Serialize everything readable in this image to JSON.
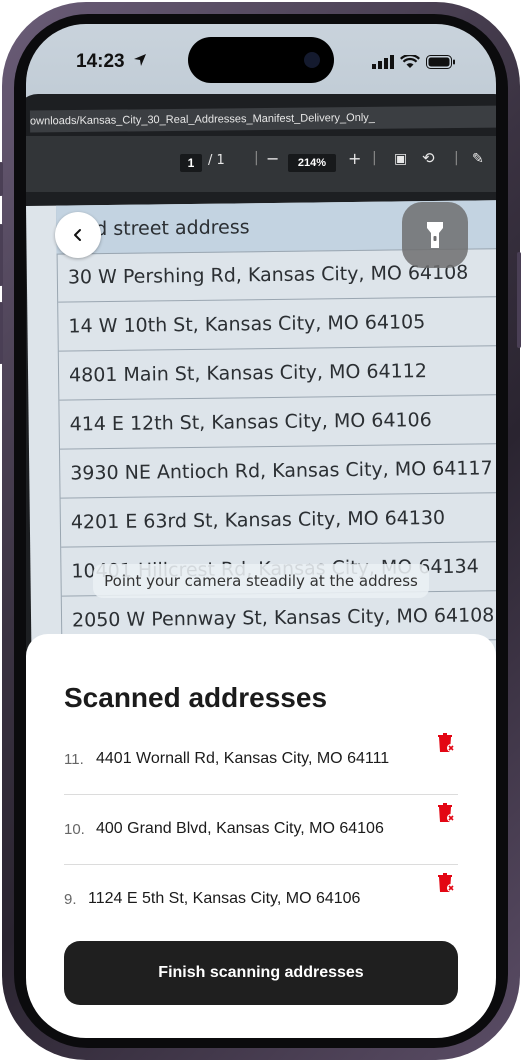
{
  "status_bar": {
    "time": "14:23"
  },
  "camera_view": {
    "pdf_filename": "ownloads/Kansas_City_30_Real_Addresses_Manifest_Delivery_Only_",
    "page_current": "1",
    "page_total": "/ 1",
    "zoom": "214%",
    "column_header": "ified street address",
    "rows": [
      "30 W Pershing Rd, Kansas City, MO 64108",
      "14 W 10th St, Kansas City, MO 64105",
      "4801 Main St, Kansas City, MO 64112",
      "414 E 12th St, Kansas City, MO 64106",
      "3930 NE Antioch Rd, Kansas City, MO 64117",
      "4201 E 63rd St, Kansas City, MO 64130",
      "10401 Hillcrest Rd, Kansas City, MO 64134",
      "2050 W Pennway St, Kansas City, MO 64108"
    ]
  },
  "hint": "Point your camera steadily at the address",
  "panel": {
    "title": "Scanned addresses",
    "items": [
      {
        "num": "11.",
        "address": "4401 Wornall Rd, Kansas City, MO 64111"
      },
      {
        "num": "10.",
        "address": "400 Grand Blvd, Kansas City, MO 64106"
      },
      {
        "num": "9.",
        "address": "1124 E 5th St, Kansas City, MO 64106"
      }
    ],
    "finish_label": "Finish scanning addresses"
  },
  "icons": {
    "back": "chevron-left-icon",
    "torch": "flashlight-icon",
    "delete": "trash-icon"
  },
  "colors": {
    "delete": "#e30613",
    "button": "#1f1f1f"
  }
}
